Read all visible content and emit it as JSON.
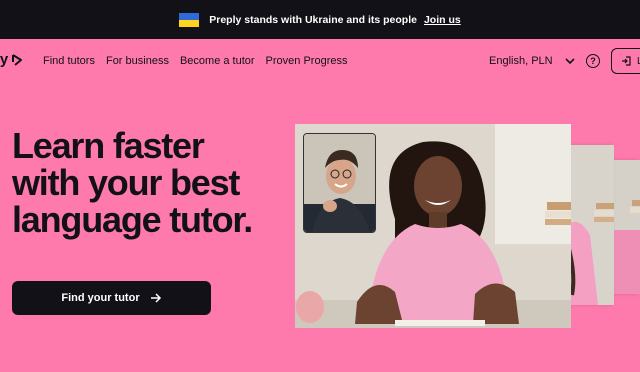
{
  "banner": {
    "message": "Preply stands with Ukraine and its people",
    "link": "Join us",
    "flag_colors": [
      "#2f6bd8",
      "#ffd21f"
    ]
  },
  "nav": {
    "logo": "ly",
    "links": [
      "Find tutors",
      "For business",
      "Become a tutor",
      "Proven Progress"
    ],
    "language": "English, PLN",
    "login_label": "L"
  },
  "hero": {
    "title_line1": "Learn faster",
    "title_line2": "with your best",
    "title_line3": "language tutor.",
    "cta_label": "Find your tutor"
  },
  "colors": {
    "background": "#ff7aac",
    "banner": "#121117",
    "text": "#121117"
  },
  "icons": [
    "flag-ukraine-icon",
    "preply-logo-icon",
    "chevron-down-icon",
    "help-icon",
    "login-icon",
    "arrow-right-icon"
  ]
}
